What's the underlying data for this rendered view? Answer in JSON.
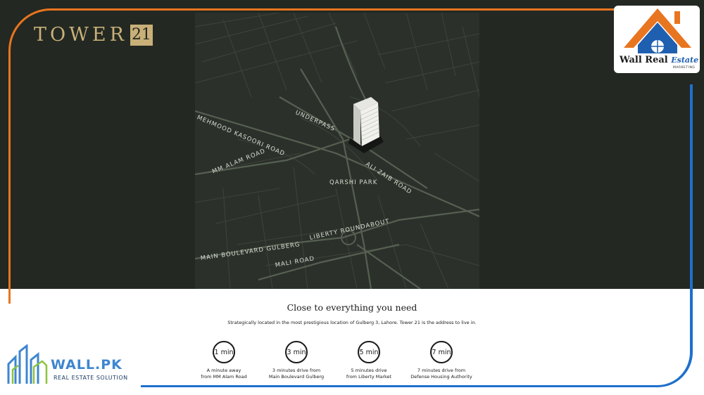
{
  "brand": {
    "tower_word": "TOWER",
    "tower_number": "21",
    "wre_name": "Wall Real",
    "wre_script": "Estate",
    "wre_sub": "MARKETING",
    "wallpk_name": "WALL.PK",
    "wallpk_tagline": "REAL ESTATE SOLUTION"
  },
  "map": {
    "labels": [
      "UNDERPASS",
      "MEHMOOD KASOORI ROAD",
      "MM ALAM ROAD",
      "ALI ZAIB ROAD",
      "QARSHI PARK",
      "LIBERTY ROUNDABOUT",
      "MAIN BOULEVARD GULBERG",
      "MALI ROAD"
    ]
  },
  "content": {
    "headline": "Close to everything you need",
    "subline": "Strategically located in the most prestigious location of Gulberg 3, Lahore. Tower 21 is the address to live in.",
    "stats": [
      {
        "time": "1 min",
        "line1": "A minute away",
        "line2": "from MM Alam Road"
      },
      {
        "time": "3 min",
        "line1": "3 minutes drive from",
        "line2": "Main Boulevard Gulberg"
      },
      {
        "time": "5 min",
        "line1": "5 minutes drive",
        "line2": "from Liberty Market"
      },
      {
        "time": "7 min",
        "line1": "7 minutes drive from",
        "line2": "Defense Housing Authority"
      }
    ]
  },
  "colors": {
    "dark_bg": "#232822",
    "gold": "#c8b078",
    "orange": "#e8751f",
    "blue": "#1f6fcc"
  }
}
